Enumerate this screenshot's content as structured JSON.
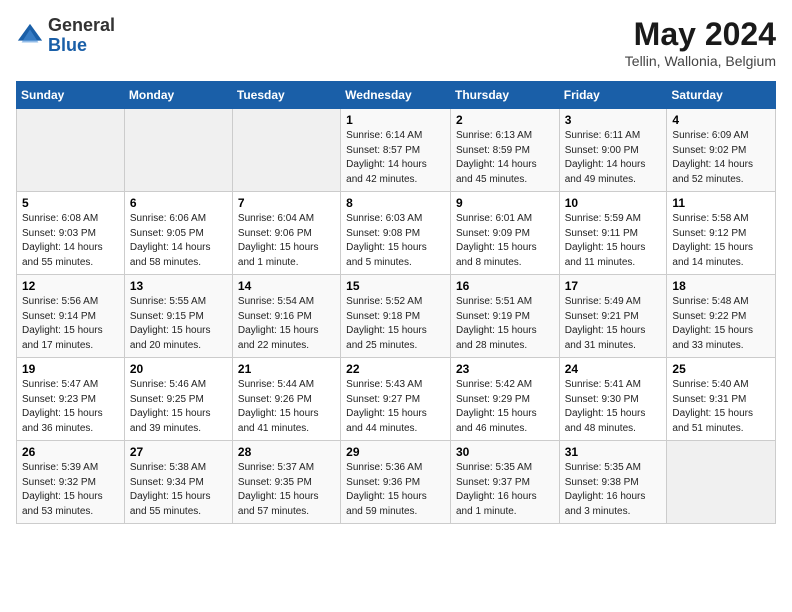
{
  "header": {
    "logo_general": "General",
    "logo_blue": "Blue",
    "month_year": "May 2024",
    "location": "Tellin, Wallonia, Belgium"
  },
  "weekdays": [
    "Sunday",
    "Monday",
    "Tuesday",
    "Wednesday",
    "Thursday",
    "Friday",
    "Saturday"
  ],
  "weeks": [
    [
      {
        "day": "",
        "sunrise": "",
        "sunset": "",
        "daylight": ""
      },
      {
        "day": "",
        "sunrise": "",
        "sunset": "",
        "daylight": ""
      },
      {
        "day": "",
        "sunrise": "",
        "sunset": "",
        "daylight": ""
      },
      {
        "day": "1",
        "sunrise": "Sunrise: 6:14 AM",
        "sunset": "Sunset: 8:57 PM",
        "daylight": "Daylight: 14 hours and 42 minutes."
      },
      {
        "day": "2",
        "sunrise": "Sunrise: 6:13 AM",
        "sunset": "Sunset: 8:59 PM",
        "daylight": "Daylight: 14 hours and 45 minutes."
      },
      {
        "day": "3",
        "sunrise": "Sunrise: 6:11 AM",
        "sunset": "Sunset: 9:00 PM",
        "daylight": "Daylight: 14 hours and 49 minutes."
      },
      {
        "day": "4",
        "sunrise": "Sunrise: 6:09 AM",
        "sunset": "Sunset: 9:02 PM",
        "daylight": "Daylight: 14 hours and 52 minutes."
      }
    ],
    [
      {
        "day": "5",
        "sunrise": "Sunrise: 6:08 AM",
        "sunset": "Sunset: 9:03 PM",
        "daylight": "Daylight: 14 hours and 55 minutes."
      },
      {
        "day": "6",
        "sunrise": "Sunrise: 6:06 AM",
        "sunset": "Sunset: 9:05 PM",
        "daylight": "Daylight: 14 hours and 58 minutes."
      },
      {
        "day": "7",
        "sunrise": "Sunrise: 6:04 AM",
        "sunset": "Sunset: 9:06 PM",
        "daylight": "Daylight: 15 hours and 1 minute."
      },
      {
        "day": "8",
        "sunrise": "Sunrise: 6:03 AM",
        "sunset": "Sunset: 9:08 PM",
        "daylight": "Daylight: 15 hours and 5 minutes."
      },
      {
        "day": "9",
        "sunrise": "Sunrise: 6:01 AM",
        "sunset": "Sunset: 9:09 PM",
        "daylight": "Daylight: 15 hours and 8 minutes."
      },
      {
        "day": "10",
        "sunrise": "Sunrise: 5:59 AM",
        "sunset": "Sunset: 9:11 PM",
        "daylight": "Daylight: 15 hours and 11 minutes."
      },
      {
        "day": "11",
        "sunrise": "Sunrise: 5:58 AM",
        "sunset": "Sunset: 9:12 PM",
        "daylight": "Daylight: 15 hours and 14 minutes."
      }
    ],
    [
      {
        "day": "12",
        "sunrise": "Sunrise: 5:56 AM",
        "sunset": "Sunset: 9:14 PM",
        "daylight": "Daylight: 15 hours and 17 minutes."
      },
      {
        "day": "13",
        "sunrise": "Sunrise: 5:55 AM",
        "sunset": "Sunset: 9:15 PM",
        "daylight": "Daylight: 15 hours and 20 minutes."
      },
      {
        "day": "14",
        "sunrise": "Sunrise: 5:54 AM",
        "sunset": "Sunset: 9:16 PM",
        "daylight": "Daylight: 15 hours and 22 minutes."
      },
      {
        "day": "15",
        "sunrise": "Sunrise: 5:52 AM",
        "sunset": "Sunset: 9:18 PM",
        "daylight": "Daylight: 15 hours and 25 minutes."
      },
      {
        "day": "16",
        "sunrise": "Sunrise: 5:51 AM",
        "sunset": "Sunset: 9:19 PM",
        "daylight": "Daylight: 15 hours and 28 minutes."
      },
      {
        "day": "17",
        "sunrise": "Sunrise: 5:49 AM",
        "sunset": "Sunset: 9:21 PM",
        "daylight": "Daylight: 15 hours and 31 minutes."
      },
      {
        "day": "18",
        "sunrise": "Sunrise: 5:48 AM",
        "sunset": "Sunset: 9:22 PM",
        "daylight": "Daylight: 15 hours and 33 minutes."
      }
    ],
    [
      {
        "day": "19",
        "sunrise": "Sunrise: 5:47 AM",
        "sunset": "Sunset: 9:23 PM",
        "daylight": "Daylight: 15 hours and 36 minutes."
      },
      {
        "day": "20",
        "sunrise": "Sunrise: 5:46 AM",
        "sunset": "Sunset: 9:25 PM",
        "daylight": "Daylight: 15 hours and 39 minutes."
      },
      {
        "day": "21",
        "sunrise": "Sunrise: 5:44 AM",
        "sunset": "Sunset: 9:26 PM",
        "daylight": "Daylight: 15 hours and 41 minutes."
      },
      {
        "day": "22",
        "sunrise": "Sunrise: 5:43 AM",
        "sunset": "Sunset: 9:27 PM",
        "daylight": "Daylight: 15 hours and 44 minutes."
      },
      {
        "day": "23",
        "sunrise": "Sunrise: 5:42 AM",
        "sunset": "Sunset: 9:29 PM",
        "daylight": "Daylight: 15 hours and 46 minutes."
      },
      {
        "day": "24",
        "sunrise": "Sunrise: 5:41 AM",
        "sunset": "Sunset: 9:30 PM",
        "daylight": "Daylight: 15 hours and 48 minutes."
      },
      {
        "day": "25",
        "sunrise": "Sunrise: 5:40 AM",
        "sunset": "Sunset: 9:31 PM",
        "daylight": "Daylight: 15 hours and 51 minutes."
      }
    ],
    [
      {
        "day": "26",
        "sunrise": "Sunrise: 5:39 AM",
        "sunset": "Sunset: 9:32 PM",
        "daylight": "Daylight: 15 hours and 53 minutes."
      },
      {
        "day": "27",
        "sunrise": "Sunrise: 5:38 AM",
        "sunset": "Sunset: 9:34 PM",
        "daylight": "Daylight: 15 hours and 55 minutes."
      },
      {
        "day": "28",
        "sunrise": "Sunrise: 5:37 AM",
        "sunset": "Sunset: 9:35 PM",
        "daylight": "Daylight: 15 hours and 57 minutes."
      },
      {
        "day": "29",
        "sunrise": "Sunrise: 5:36 AM",
        "sunset": "Sunset: 9:36 PM",
        "daylight": "Daylight: 15 hours and 59 minutes."
      },
      {
        "day": "30",
        "sunrise": "Sunrise: 5:35 AM",
        "sunset": "Sunset: 9:37 PM",
        "daylight": "Daylight: 16 hours and 1 minute."
      },
      {
        "day": "31",
        "sunrise": "Sunrise: 5:35 AM",
        "sunset": "Sunset: 9:38 PM",
        "daylight": "Daylight: 16 hours and 3 minutes."
      },
      {
        "day": "",
        "sunrise": "",
        "sunset": "",
        "daylight": ""
      }
    ]
  ]
}
